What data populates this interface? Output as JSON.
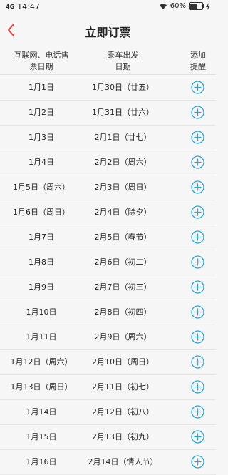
{
  "status_bar": {
    "signal": "4G",
    "time": "14:47",
    "battery_text": "60%",
    "battery_level": 0.6
  },
  "header": {
    "title": "立即订票"
  },
  "table_head": {
    "col_sale": [
      "互联网、电话售",
      "票日期"
    ],
    "col_depart": [
      "乘车出发",
      "日期"
    ],
    "col_add": [
      "添加",
      "提醒"
    ]
  },
  "rows": [
    {
      "sale": "1月1日",
      "depart": "1月30日（廿五）"
    },
    {
      "sale": "1月2日",
      "depart": "1月31日（廿六）"
    },
    {
      "sale": "1月3日",
      "depart": "2月1日（廿七）"
    },
    {
      "sale": "1月4日",
      "depart": "2月2日（周六）"
    },
    {
      "sale": "1月5日（周六）",
      "depart": "2月3日（周日）"
    },
    {
      "sale": "1月6日（周日）",
      "depart": "2月4日（除夕）"
    },
    {
      "sale": "1月7日",
      "depart": "2月5日（春节）"
    },
    {
      "sale": "1月8日",
      "depart": "2月6日（初二）"
    },
    {
      "sale": "1月9日",
      "depart": "2月7日（初三）"
    },
    {
      "sale": "1月10日",
      "depart": "2月8日（初四）"
    },
    {
      "sale": "1月11日",
      "depart": "2月9日（周六）"
    },
    {
      "sale": "1月12日（周六）",
      "depart": "2月10日（周日）"
    },
    {
      "sale": "1月13日（周日）",
      "depart": "2月11日（初七）"
    },
    {
      "sale": "1月14日",
      "depart": "2月12日（初八）"
    },
    {
      "sale": "1月15日",
      "depart": "2月13日（初九）"
    },
    {
      "sale": "1月16日",
      "depart": "2月14日（情人节）"
    }
  ],
  "colors": {
    "accent_red": "#e8453c",
    "add_blue": "#2aa8d8"
  }
}
